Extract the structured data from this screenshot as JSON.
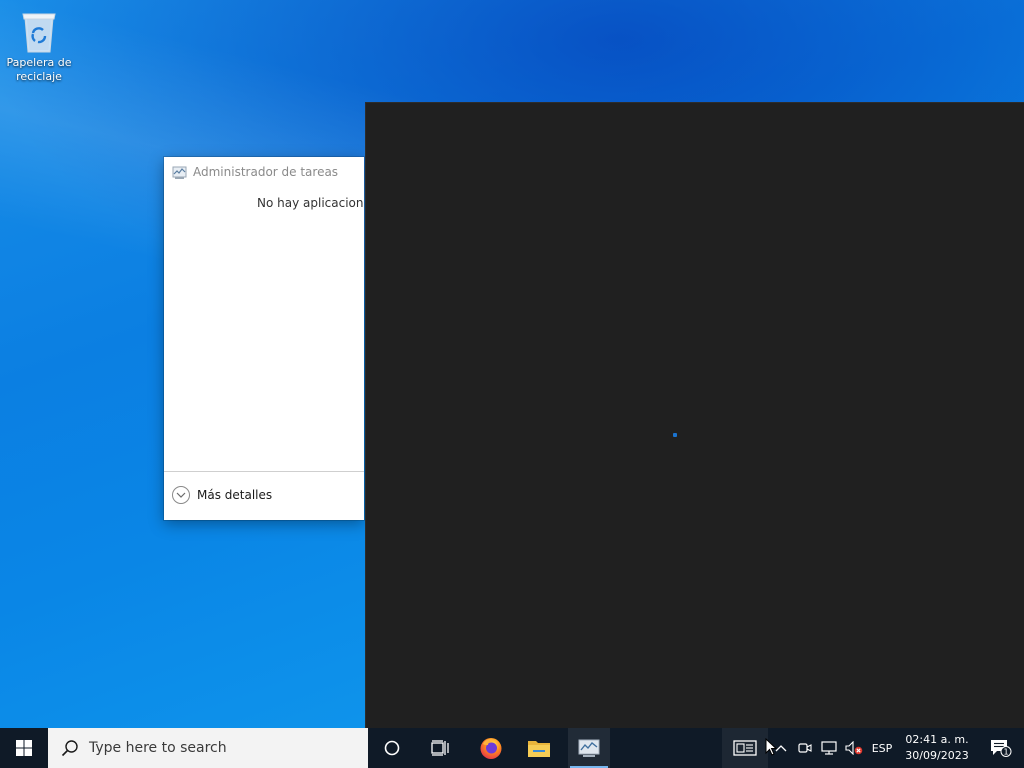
{
  "desktop": {
    "icons": [
      {
        "label": "Papelera de reciclaje",
        "icon": "recycle-bin-icon"
      }
    ]
  },
  "task_manager": {
    "title": "Administrador de tareas",
    "empty_message": "No hay aplicaciones",
    "more_details": "Más detalles"
  },
  "taskbar": {
    "search_placeholder": "Type here to search",
    "pinned": [
      {
        "name": "firefox",
        "icon": "firefox-icon"
      },
      {
        "name": "file-explorer",
        "icon": "folder-icon"
      },
      {
        "name": "task-manager",
        "icon": "task-manager-icon",
        "active": true
      }
    ],
    "tray": {
      "language": "ESP",
      "time": "02:41 a. m.",
      "date": "30/09/2023",
      "notification_count": "1",
      "volume_muted": true
    }
  },
  "colors": {
    "taskbar": "#0f1a27",
    "dark_window": "#202020",
    "accent": "#1a73d0"
  }
}
